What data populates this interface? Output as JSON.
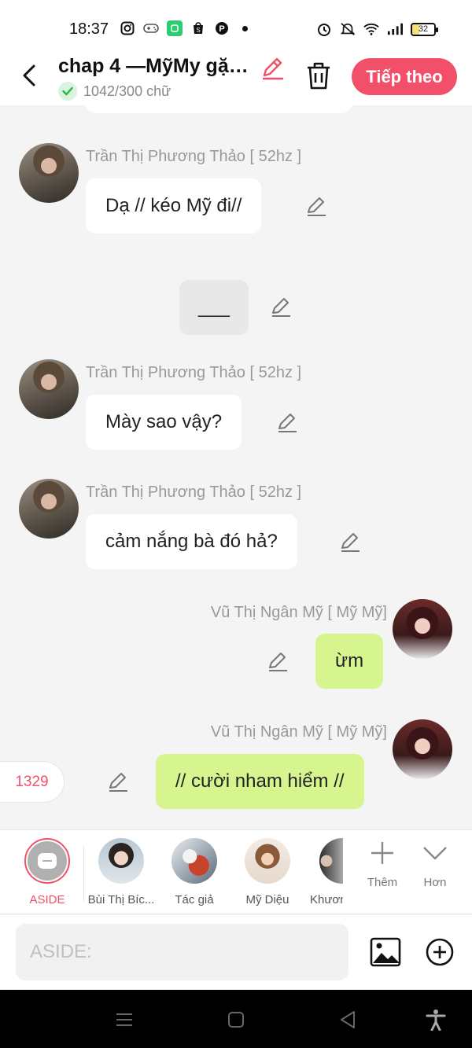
{
  "status_bar": {
    "time": "18:37",
    "battery": "32",
    "left_icons": [
      "instagram-icon",
      "gamepad-icon",
      "app-icon",
      "shopee-icon",
      "pinterest-icon",
      "dot-icon"
    ],
    "right_icons": [
      "alarm-icon",
      "mute-icon",
      "wifi-icon",
      "signal-icon",
      "battery-icon"
    ]
  },
  "header": {
    "title": "chap 4 —MỹMy gặp...",
    "word_count": "1042/300 chữ",
    "next_label": "Tiếp theo",
    "accent_color": "#f2506a"
  },
  "messages": [
    {
      "side": "left",
      "sender": "Trần Thị Phương Thảo [ 52hz ]",
      "text": "Dạ // kéo Mỹ đi//"
    },
    {
      "side": "center",
      "sender": "",
      "text": "___"
    },
    {
      "side": "left",
      "sender": "Trần Thị Phương Thảo [ 52hz ]",
      "text": "Mày sao vậy?"
    },
    {
      "side": "left",
      "sender": "Trần Thị Phương Thảo [ 52hz ]",
      "text": "cảm nắng bà đó hả?"
    },
    {
      "side": "right",
      "sender": "Vũ Thị Ngân Mỹ [ Mỹ Mỹ]",
      "text": "ừm"
    },
    {
      "side": "right",
      "sender": "Vũ Thị Ngân Mỹ [ Mỹ Mỹ]",
      "text": "// cười nham hiểm //"
    }
  ],
  "count_badge": "1329",
  "characters": [
    {
      "label": "ASIDE"
    },
    {
      "label": "Bùi Thị Bíc..."
    },
    {
      "label": "Tác giả"
    },
    {
      "label": "Mỹ Diệu"
    },
    {
      "label": "Khươn"
    }
  ],
  "tools": {
    "add_label": "Thêm",
    "more_label": "Hơn"
  },
  "input": {
    "placeholder": "ASIDE:",
    "value": ""
  }
}
